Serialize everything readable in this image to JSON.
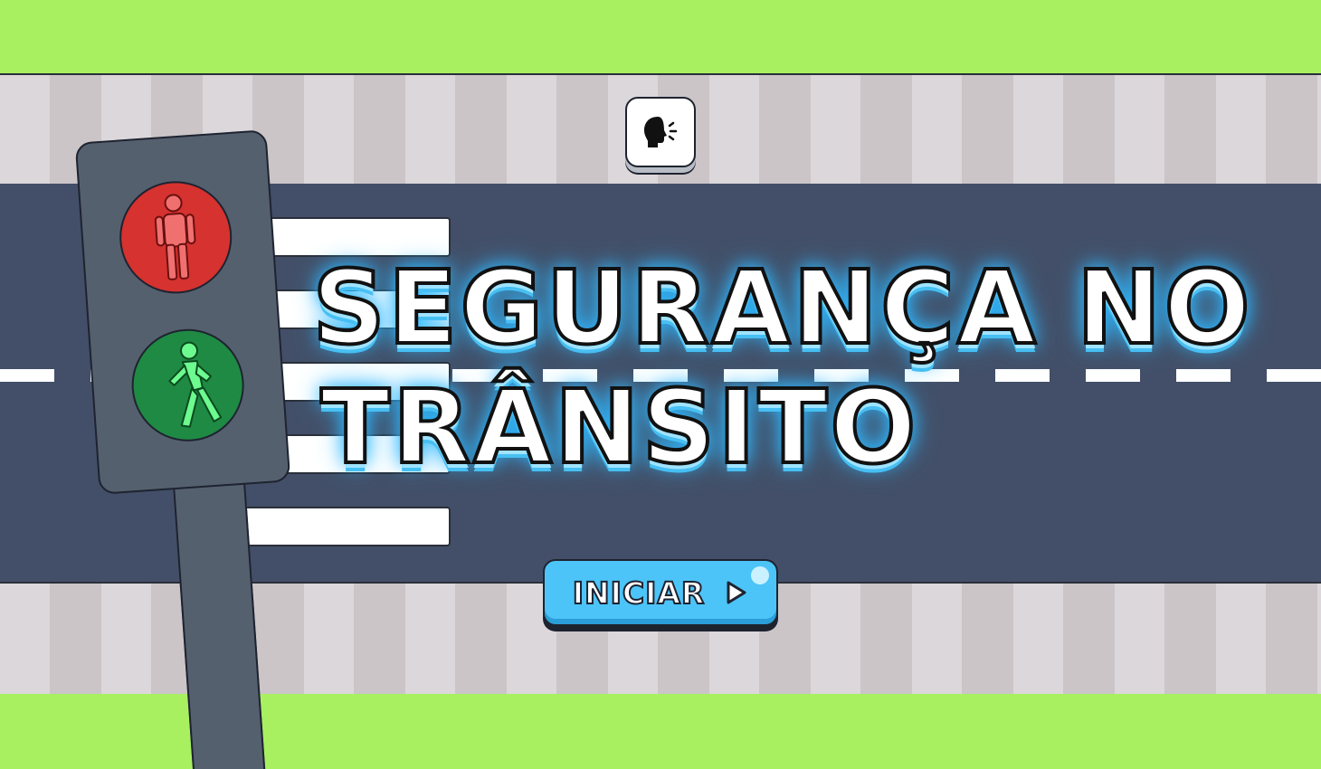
{
  "title": {
    "line1": "SEGURANÇA NO",
    "line2": "TRÂNSITO"
  },
  "start_button": {
    "label": "INICIAR",
    "icon": "play-icon"
  },
  "voice_button": {
    "icon": "speaking-head-icon"
  },
  "traffic_light": {
    "top_lamp": "pedestrian-stop-icon",
    "bottom_lamp": "pedestrian-walk-icon"
  },
  "colors": {
    "grass": "#a8f060",
    "road": "#434f68",
    "sidewalk_light": "#dcd7da",
    "sidewalk_dark": "#cbc5c8",
    "title_glow": "#2fb8ff",
    "button": "#4cc4f8",
    "red_lamp": "#d6322f",
    "green_lamp": "#1f8a43"
  }
}
